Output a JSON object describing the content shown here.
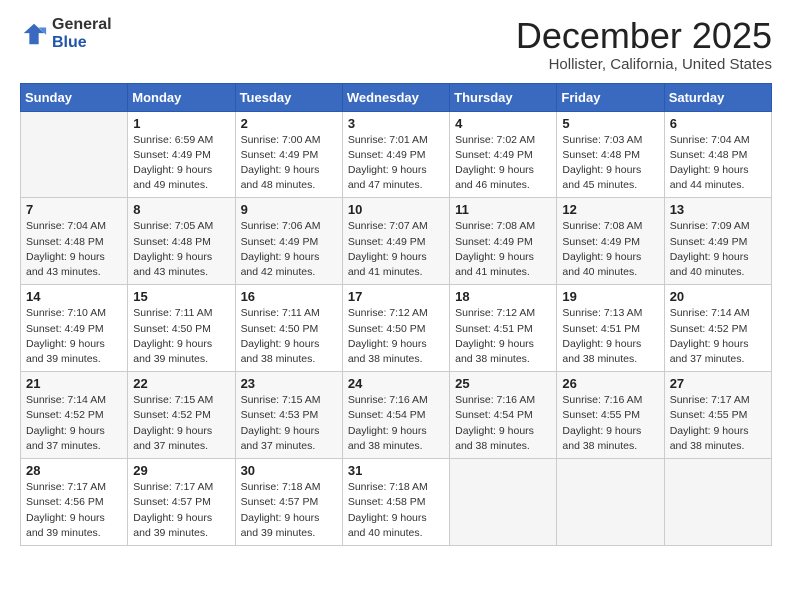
{
  "header": {
    "logo_line1": "General",
    "logo_line2": "Blue",
    "month": "December 2025",
    "location": "Hollister, California, United States"
  },
  "days_of_week": [
    "Sunday",
    "Monday",
    "Tuesday",
    "Wednesday",
    "Thursday",
    "Friday",
    "Saturday"
  ],
  "weeks": [
    [
      {
        "day": "",
        "info": ""
      },
      {
        "day": "1",
        "info": "Sunrise: 6:59 AM\nSunset: 4:49 PM\nDaylight: 9 hours\nand 49 minutes."
      },
      {
        "day": "2",
        "info": "Sunrise: 7:00 AM\nSunset: 4:49 PM\nDaylight: 9 hours\nand 48 minutes."
      },
      {
        "day": "3",
        "info": "Sunrise: 7:01 AM\nSunset: 4:49 PM\nDaylight: 9 hours\nand 47 minutes."
      },
      {
        "day": "4",
        "info": "Sunrise: 7:02 AM\nSunset: 4:49 PM\nDaylight: 9 hours\nand 46 minutes."
      },
      {
        "day": "5",
        "info": "Sunrise: 7:03 AM\nSunset: 4:48 PM\nDaylight: 9 hours\nand 45 minutes."
      },
      {
        "day": "6",
        "info": "Sunrise: 7:04 AM\nSunset: 4:48 PM\nDaylight: 9 hours\nand 44 minutes."
      }
    ],
    [
      {
        "day": "7",
        "info": "Sunrise: 7:04 AM\nSunset: 4:48 PM\nDaylight: 9 hours\nand 43 minutes."
      },
      {
        "day": "8",
        "info": "Sunrise: 7:05 AM\nSunset: 4:48 PM\nDaylight: 9 hours\nand 43 minutes."
      },
      {
        "day": "9",
        "info": "Sunrise: 7:06 AM\nSunset: 4:49 PM\nDaylight: 9 hours\nand 42 minutes."
      },
      {
        "day": "10",
        "info": "Sunrise: 7:07 AM\nSunset: 4:49 PM\nDaylight: 9 hours\nand 41 minutes."
      },
      {
        "day": "11",
        "info": "Sunrise: 7:08 AM\nSunset: 4:49 PM\nDaylight: 9 hours\nand 41 minutes."
      },
      {
        "day": "12",
        "info": "Sunrise: 7:08 AM\nSunset: 4:49 PM\nDaylight: 9 hours\nand 40 minutes."
      },
      {
        "day": "13",
        "info": "Sunrise: 7:09 AM\nSunset: 4:49 PM\nDaylight: 9 hours\nand 40 minutes."
      }
    ],
    [
      {
        "day": "14",
        "info": "Sunrise: 7:10 AM\nSunset: 4:49 PM\nDaylight: 9 hours\nand 39 minutes."
      },
      {
        "day": "15",
        "info": "Sunrise: 7:11 AM\nSunset: 4:50 PM\nDaylight: 9 hours\nand 39 minutes."
      },
      {
        "day": "16",
        "info": "Sunrise: 7:11 AM\nSunset: 4:50 PM\nDaylight: 9 hours\nand 38 minutes."
      },
      {
        "day": "17",
        "info": "Sunrise: 7:12 AM\nSunset: 4:50 PM\nDaylight: 9 hours\nand 38 minutes."
      },
      {
        "day": "18",
        "info": "Sunrise: 7:12 AM\nSunset: 4:51 PM\nDaylight: 9 hours\nand 38 minutes."
      },
      {
        "day": "19",
        "info": "Sunrise: 7:13 AM\nSunset: 4:51 PM\nDaylight: 9 hours\nand 38 minutes."
      },
      {
        "day": "20",
        "info": "Sunrise: 7:14 AM\nSunset: 4:52 PM\nDaylight: 9 hours\nand 37 minutes."
      }
    ],
    [
      {
        "day": "21",
        "info": "Sunrise: 7:14 AM\nSunset: 4:52 PM\nDaylight: 9 hours\nand 37 minutes."
      },
      {
        "day": "22",
        "info": "Sunrise: 7:15 AM\nSunset: 4:52 PM\nDaylight: 9 hours\nand 37 minutes."
      },
      {
        "day": "23",
        "info": "Sunrise: 7:15 AM\nSunset: 4:53 PM\nDaylight: 9 hours\nand 37 minutes."
      },
      {
        "day": "24",
        "info": "Sunrise: 7:16 AM\nSunset: 4:54 PM\nDaylight: 9 hours\nand 38 minutes."
      },
      {
        "day": "25",
        "info": "Sunrise: 7:16 AM\nSunset: 4:54 PM\nDaylight: 9 hours\nand 38 minutes."
      },
      {
        "day": "26",
        "info": "Sunrise: 7:16 AM\nSunset: 4:55 PM\nDaylight: 9 hours\nand 38 minutes."
      },
      {
        "day": "27",
        "info": "Sunrise: 7:17 AM\nSunset: 4:55 PM\nDaylight: 9 hours\nand 38 minutes."
      }
    ],
    [
      {
        "day": "28",
        "info": "Sunrise: 7:17 AM\nSunset: 4:56 PM\nDaylight: 9 hours\nand 39 minutes."
      },
      {
        "day": "29",
        "info": "Sunrise: 7:17 AM\nSunset: 4:57 PM\nDaylight: 9 hours\nand 39 minutes."
      },
      {
        "day": "30",
        "info": "Sunrise: 7:18 AM\nSunset: 4:57 PM\nDaylight: 9 hours\nand 39 minutes."
      },
      {
        "day": "31",
        "info": "Sunrise: 7:18 AM\nSunset: 4:58 PM\nDaylight: 9 hours\nand 40 minutes."
      },
      {
        "day": "",
        "info": ""
      },
      {
        "day": "",
        "info": ""
      },
      {
        "day": "",
        "info": ""
      }
    ]
  ]
}
